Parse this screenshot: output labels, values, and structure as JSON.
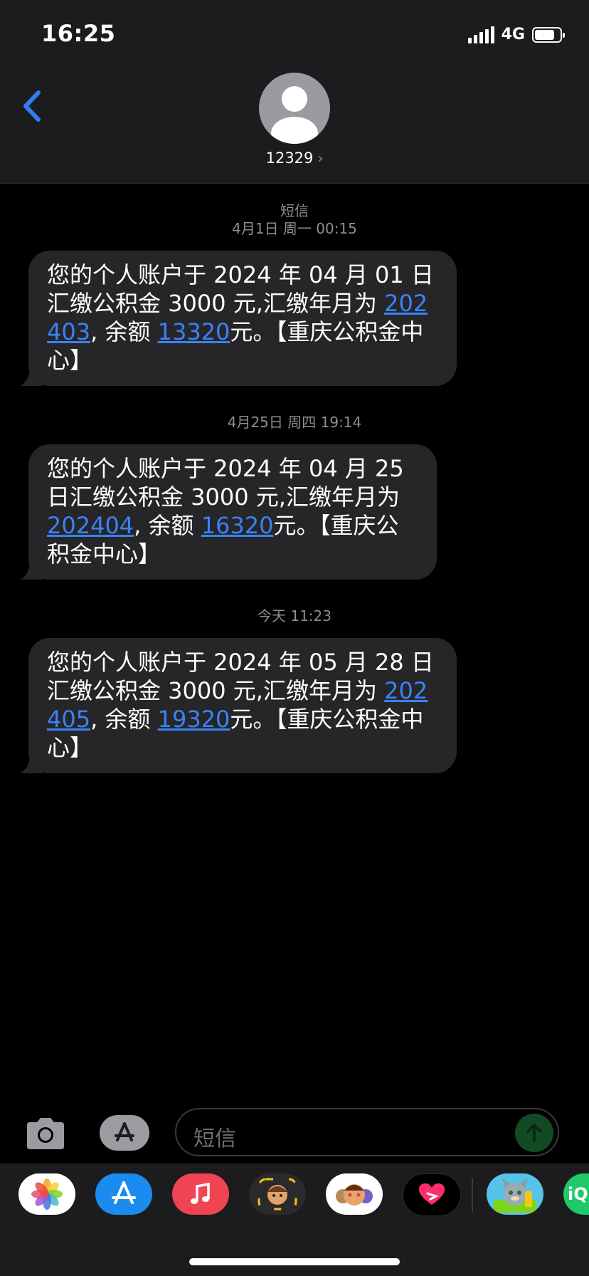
{
  "status_bar": {
    "time": "16:25",
    "network": "4G",
    "battery_level": 0.8
  },
  "header": {
    "contact": "12329"
  },
  "conversation": [
    {
      "label": "短信",
      "timestamp": "4月1日 周一 00:15",
      "text_a": "您的个人账户于 2024 年 04 月 01 日汇缴公积金 3000 元,汇缴年月为 ",
      "link_month": "202403",
      "text_b": ", 余额 ",
      "link_balance": "13320",
      "text_c": "元。【重庆公积金中心】"
    },
    {
      "label": "",
      "timestamp": "4月25日 周四 19:14",
      "text_a": "您的个人账户于 2024 年 04 月 25 日汇缴公积金 3000 元,汇缴年月为 ",
      "link_month": "202404",
      "text_b": ", 余额 ",
      "link_balance": "16320",
      "text_c": "元。【重庆公积金中心】"
    },
    {
      "label": "",
      "timestamp": "今天 11:23",
      "text_a": "您的个人账户于 2024 年 05 月 28 日汇缴公积金 3000 元,汇缴年月为 ",
      "link_month": "202405",
      "text_b": ", 余额 ",
      "link_balance": "19320",
      "text_c": "元。【重庆公积金中心】"
    }
  ],
  "composer": {
    "placeholder": "短信"
  },
  "app_tray": [
    {
      "icon": "photos-icon"
    },
    {
      "icon": "app-store-icon"
    },
    {
      "icon": "music-icon"
    },
    {
      "icon": "memoji-icon"
    },
    {
      "icon": "animoji-icon"
    },
    {
      "icon": "digital-touch-icon"
    },
    {
      "icon": "talking-tom-icon"
    },
    {
      "icon": "iqiyi-icon",
      "label": "iQ"
    }
  ],
  "colors": {
    "link": "#3a82f7",
    "bubble": "#262628",
    "header": "#1c1c1e",
    "send": "#124a24"
  }
}
